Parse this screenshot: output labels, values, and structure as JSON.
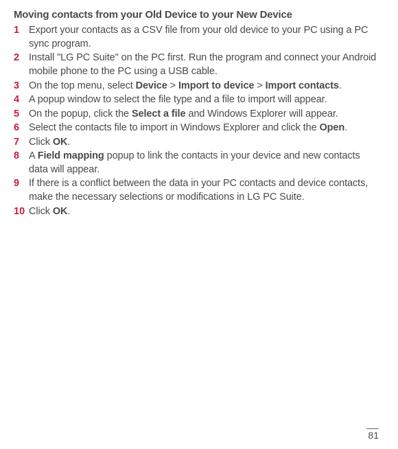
{
  "heading": "Moving contacts from your Old Device to your New Device",
  "steps": [
    {
      "num": "1",
      "pre": "Export your contacts as a CSV file from your old device to your PC using a PC sync program."
    },
    {
      "num": "2",
      "pre": "Install \"LG PC Suite\" on the PC first. Run the program and connect your Android mobile phone to the PC using a USB cable."
    },
    {
      "num": "3",
      "pre": "On the top menu, select ",
      "b1": "Device",
      "mid1": " > ",
      "b2": "Import to device",
      "mid2": " > ",
      "b3": "Import contacts",
      "post": "."
    },
    {
      "num": "4",
      "pre": "A popup window to select the file type and a file to import will appear."
    },
    {
      "num": "5",
      "pre": "On the popup, click the ",
      "b1": "Select a file",
      "post": " and Windows Explorer will appear."
    },
    {
      "num": "6",
      "pre": "Select the contacts file to import in Windows Explorer and click the ",
      "b1": "Open",
      "post": "."
    },
    {
      "num": "7",
      "pre": "Click ",
      "b1": "OK",
      "post": "."
    },
    {
      "num": "8",
      "pre": "A ",
      "b1": "Field mapping",
      "post": " popup to link the contacts in your device and new contacts data will appear."
    },
    {
      "num": "9",
      "pre": "If there is a conflict between the data in your PC contacts and device contacts, make the necessary selections or modifications in LG PC Suite."
    },
    {
      "num": "10",
      "pre": "Click ",
      "b1": "OK",
      "post": "."
    }
  ],
  "pageNumber": "81"
}
